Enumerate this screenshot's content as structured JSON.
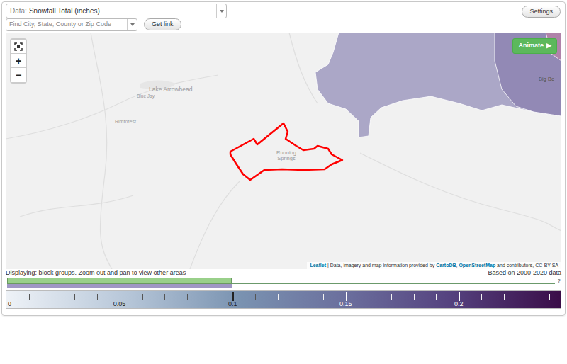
{
  "dataset_select": {
    "label": "Data:",
    "value": "Snowfall Total (inches)"
  },
  "settings_button": "Settings",
  "search": {
    "placeholder": "Find City, State, County or Zip Code"
  },
  "get_link_button": "Get link",
  "map": {
    "zoom_buttons": [
      {
        "kind": "fullscreen",
        "label": ""
      },
      {
        "kind": "text",
        "label": "+"
      },
      {
        "kind": "text",
        "label": "−"
      }
    ],
    "animate_button": {
      "label": "Animate",
      "icon": "▶"
    },
    "labels": [
      {
        "text": "Lake Arrowhead"
      },
      {
        "text": "Blue Jay"
      },
      {
        "text": "Rimforest"
      },
      {
        "text": "Running Springs"
      },
      {
        "text": "Big Be"
      }
    ],
    "regions": [
      {
        "color": "#a39fc2"
      },
      {
        "color": "#8f86b2"
      },
      {
        "color": "#b483a9"
      }
    ],
    "attribution": [
      {
        "text": "Leaflet",
        "link": true
      },
      {
        "text": " | Data, imagery and map information provided by ",
        "link": false
      },
      {
        "text": "CartoDB",
        "link": true
      },
      {
        "text": ", ",
        "link": false
      },
      {
        "text": "OpenStreetMap",
        "link": true
      },
      {
        "text": " and contributors, CC-BY-SA",
        "link": false
      }
    ]
  },
  "status": {
    "left": "Displaying: block groups. Zoom out and pan to view other areas",
    "right": "Based on 2000-2020 data"
  },
  "timeline": {
    "level": 0.41,
    "end_label": "?"
  },
  "legend": {
    "max": 0.245,
    "minor_step": 0.01,
    "ticks": [
      {
        "label": "0",
        "value": 0
      },
      {
        "label": "0.05",
        "value": 0.05
      },
      {
        "label": "0.1",
        "value": 0.1
      },
      {
        "label": "0.15",
        "value": 0.15
      },
      {
        "label": "0.2",
        "value": 0.2
      }
    ]
  }
}
